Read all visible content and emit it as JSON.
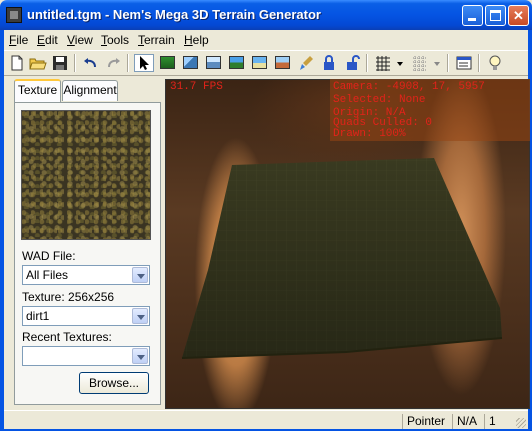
{
  "window": {
    "title": "untitled.tgm - Nem's Mega 3D Terrain Generator"
  },
  "menu": {
    "items": [
      {
        "label": "File",
        "u": "F",
        "rest": "ile"
      },
      {
        "label": "Edit",
        "u": "E",
        "rest": "dit"
      },
      {
        "label": "View",
        "u": "V",
        "rest": "iew"
      },
      {
        "label": "Tools",
        "u": "T",
        "rest": "ools"
      },
      {
        "label": "Terrain",
        "u": "T",
        "rest": "errain"
      },
      {
        "label": "Help",
        "u": "H",
        "rest": "elp"
      }
    ]
  },
  "toolbar": {
    "icons": [
      "new-file-icon",
      "open-folder-icon",
      "save-disk-icon",
      "undo-icon",
      "redo-icon",
      "pointer-arrow-icon",
      "terrain-tool-1-icon",
      "terrain-tool-2-icon",
      "terrain-tool-3-icon",
      "terrain-tool-4-icon",
      "terrain-tool-5-icon",
      "terrain-tool-6-icon",
      "paint-brush-icon",
      "lock-icon",
      "unlock-icon",
      "grid-icon",
      "grid-dotted-icon",
      "properties-icon",
      "light-bulb-icon"
    ],
    "accent": "#0554e3"
  },
  "left_panel": {
    "tabs": {
      "texture": "Texture",
      "alignment": "Alignment"
    },
    "wad_label": "WAD File:",
    "wad_value": "All Files",
    "texture_label": "Texture: 256x256",
    "texture_value": "dirt1",
    "recent_label": "Recent Textures:",
    "recent_value": "",
    "browse_label": "Browse..."
  },
  "viewport": {
    "fps": "31.7 FPS",
    "camera": "Camera: -4908, 17, 5957",
    "selected": "Selected: None",
    "origin": "Origin: N/A",
    "quads_culled": "Quads Culled: 0",
    "drawn": "Drawn: 100%",
    "overlay_color": "#e2231a"
  },
  "statusbar": {
    "mode": "Pointer",
    "coord": "N/A",
    "count": "1"
  }
}
